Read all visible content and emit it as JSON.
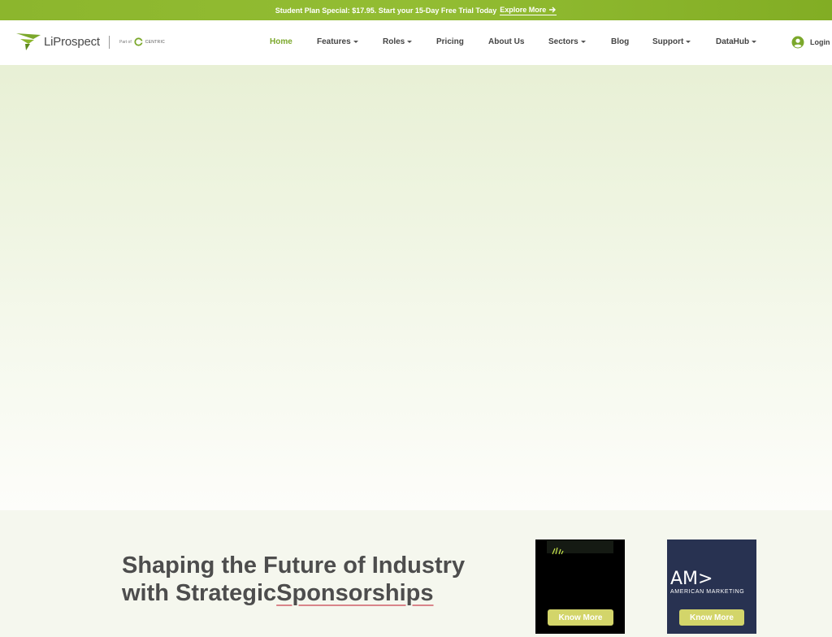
{
  "promo": {
    "text": "Student Plan Special: $17.95. Start your 15-Day Free Trial Today",
    "link_label": "Explore More",
    "icon": "arrow-right-icon"
  },
  "header": {
    "logo_text": "LiProspect",
    "part_of": "Part of",
    "partner_name": "CENTRIC",
    "nav": [
      {
        "label": "Home",
        "active": true,
        "dropdown": false
      },
      {
        "label": "Features",
        "active": false,
        "dropdown": true
      },
      {
        "label": "Roles",
        "active": false,
        "dropdown": true
      },
      {
        "label": "Pricing",
        "active": false,
        "dropdown": false
      },
      {
        "label": "About Us",
        "active": false,
        "dropdown": false
      },
      {
        "label": "Sectors",
        "active": false,
        "dropdown": true
      },
      {
        "label": "Blog",
        "active": false,
        "dropdown": false
      },
      {
        "label": "Support",
        "active": false,
        "dropdown": true
      },
      {
        "label": "DataHub",
        "active": false,
        "dropdown": true
      }
    ],
    "login_label": "Login",
    "login_icon": "user-circle-icon"
  },
  "sponsorship": {
    "title_line1": "Shaping the Future of Industry",
    "title_line2_a": "with Strategic",
    "title_line2_b": "Sponsorships",
    "cards": [
      {
        "button_label": "Know More"
      },
      {
        "logo_text": "AM>",
        "name": "AMERICAN MARKETING",
        "button_label": "Know More"
      }
    ]
  },
  "colors": {
    "brand_green": "#7ba82b",
    "promo_bar": "#8cb62d",
    "button_yellow": "#d3d56a",
    "card_navy": "#283251"
  }
}
